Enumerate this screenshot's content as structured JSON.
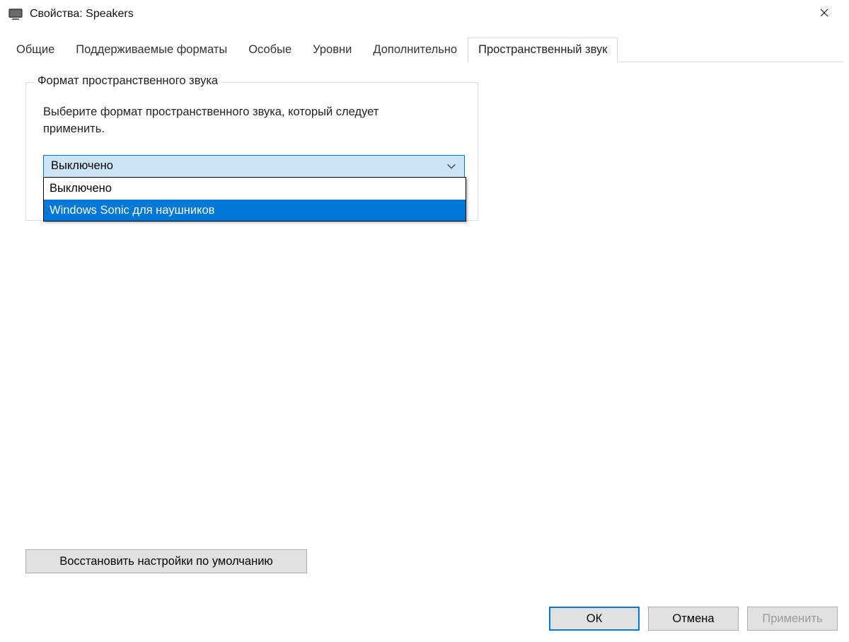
{
  "window": {
    "title": "Свойства: Speakers"
  },
  "tabs": [
    {
      "label": "Общие"
    },
    {
      "label": "Поддерживаемые форматы"
    },
    {
      "label": "Особые"
    },
    {
      "label": "Уровни"
    },
    {
      "label": "Дополнительно"
    },
    {
      "label": "Пространственный звук"
    }
  ],
  "group": {
    "title": "Формат пространственного звука",
    "instruction": "Выберите формат пространственного звука, который следует применить."
  },
  "combo": {
    "value": "Выключено",
    "options": [
      "Выключено",
      "Windows Sonic для наушников"
    ]
  },
  "buttons": {
    "restore": "Восстановить настройки по умолчанию",
    "ok": "ОК",
    "cancel": "Отмена",
    "apply": "Применить"
  }
}
